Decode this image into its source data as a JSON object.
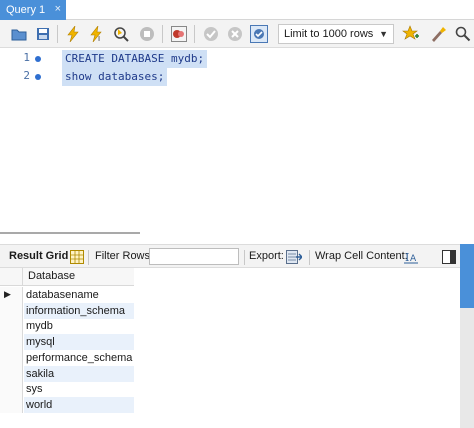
{
  "tab": {
    "title": "Query 1",
    "close_glyph": "×"
  },
  "toolbar": {
    "icons": [
      "open-file-icon",
      "save-icon",
      "execute-icon",
      "execute-current-icon",
      "explain-icon",
      "stop-icon",
      "toggle-output-icon",
      "commit-icon",
      "rollback-icon",
      "autocommit-icon",
      "add-snippet-icon",
      "beautify-icon",
      "find-icon"
    ],
    "limit_label": "Limit to 1000 rows"
  },
  "editor": {
    "lines": [
      {
        "number": "1",
        "code": "CREATE DATABASE mydb;"
      },
      {
        "number": "2",
        "code": "show databases;"
      }
    ]
  },
  "result_bar": {
    "result_grid": "Result Grid",
    "filter_rows": "Filter Rows:",
    "filter_value": "",
    "export": "Export:",
    "wrap": "Wrap Cell Content:"
  },
  "grid": {
    "column": "Database",
    "rows": [
      "databasename",
      "information_schema",
      "mydb",
      "mysql",
      "performance_schema",
      "sakila",
      "sys",
      "world"
    ],
    "selected_row": 0
  },
  "colors": {
    "accent": "#4a90d9",
    "selection": "#cfe0f5",
    "alt_row": "#e9f1fb"
  }
}
